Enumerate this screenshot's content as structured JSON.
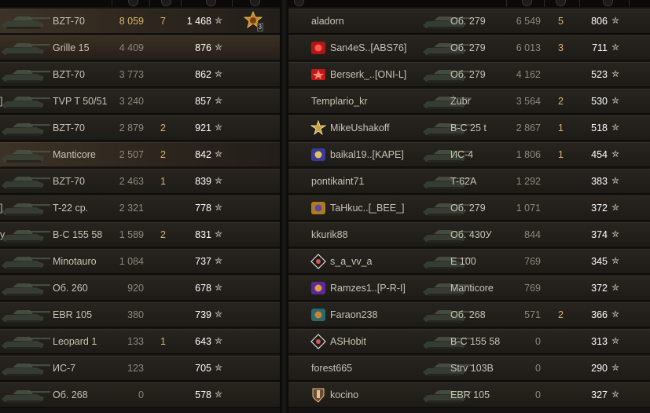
{
  "left_team": [
    {
      "player": "",
      "vehicle": "BZT-70",
      "damage": "8 059",
      "frags": "7",
      "score": "1 468",
      "medal_count": "3",
      "highlight": true
    },
    {
      "player": "",
      "vehicle": "Grille 15",
      "damage": "4 409",
      "frags": "",
      "score": "876",
      "is_player": true
    },
    {
      "player": "",
      "vehicle": "BZT-70",
      "damage": "3 773",
      "frags": "",
      "score": "862"
    },
    {
      "player": "]",
      "vehicle": "TVP T 50/51",
      "damage": "3 240",
      "frags": "",
      "score": "857"
    },
    {
      "player": "",
      "vehicle": "BZT-70",
      "damage": "2 879",
      "frags": "2",
      "score": "921"
    },
    {
      "player": "",
      "vehicle": "Manticore",
      "damage": "2 507",
      "frags": "2",
      "score": "842",
      "highlight": true
    },
    {
      "player": "",
      "vehicle": "BZT-70",
      "damage": "2 463",
      "frags": "1",
      "score": "839"
    },
    {
      "player": "]",
      "vehicle": "T-22 ср.",
      "damage": "2 321",
      "frags": "",
      "score": "778"
    },
    {
      "player": "y",
      "vehicle": "B-C 155 58",
      "damage": "1 589",
      "frags": "2",
      "score": "831"
    },
    {
      "player": "",
      "vehicle": "Minotauro",
      "damage": "1 084",
      "frags": "",
      "score": "737"
    },
    {
      "player": "",
      "vehicle": "Об. 260",
      "damage": "920",
      "frags": "",
      "score": "678"
    },
    {
      "player": "",
      "vehicle": "EBR 105",
      "damage": "380",
      "frags": "",
      "score": "739"
    },
    {
      "player": "",
      "vehicle": "Leopard 1",
      "damage": "133",
      "frags": "1",
      "score": "643"
    },
    {
      "player": "",
      "vehicle": "ИС-7",
      "damage": "123",
      "frags": "",
      "score": "705"
    },
    {
      "player": "",
      "vehicle": "Об. 268",
      "damage": "0",
      "frags": "",
      "score": "578"
    }
  ],
  "right_team": [
    {
      "player": "aladorn",
      "vehicle": "Об. 279",
      "damage": "6 549",
      "frags": "5",
      "score": "806",
      "clan_icon": "none"
    },
    {
      "player": "San4eS..[ABS76]",
      "vehicle": "Об. 279",
      "damage": "6 013",
      "frags": "3",
      "score": "711",
      "clan_icon": "clan-badge-red-icon"
    },
    {
      "player": "Berserk_..[ONI-L]",
      "vehicle": "Об. 279",
      "damage": "4 162",
      "frags": "",
      "score": "523",
      "clan_icon": "clan-badge-star-icon"
    },
    {
      "player": "Templario_kr",
      "vehicle": "Żubr",
      "damage": "3 564",
      "frags": "2",
      "score": "530",
      "clan_icon": "none"
    },
    {
      "player": "MikeUshakoff",
      "vehicle": "B-C 25 t",
      "damage": "2 867",
      "frags": "1",
      "score": "518",
      "clan_icon": "clan-badge-sun-icon"
    },
    {
      "player": "baikal19..[KAPE]",
      "vehicle": "ИС-4",
      "damage": "1 806",
      "frags": "1",
      "score": "454",
      "clan_icon": "clan-badge-emblem-icon"
    },
    {
      "player": "pontikaint71",
      "vehicle": "T-62A",
      "damage": "1 292",
      "frags": "",
      "score": "383",
      "clan_icon": "none"
    },
    {
      "player": "TaHkuc..[_BEE_]",
      "vehicle": "Об. 279",
      "damage": "1 071",
      "frags": "",
      "score": "372",
      "clan_icon": "clan-badge-bee-icon"
    },
    {
      "player": "kkurik88",
      "vehicle": "Об. 430У",
      "damage": "844",
      "frags": "",
      "score": "374",
      "clan_icon": "none"
    },
    {
      "player": "s_a_vv_a",
      "vehicle": "E 100",
      "damage": "769",
      "frags": "",
      "score": "345",
      "clan_icon": "clan-badge-diamond-icon"
    },
    {
      "player": "Ramzes1..[P-R-I]",
      "vehicle": "Manticore",
      "damage": "769",
      "frags": "",
      "score": "372",
      "clan_icon": "clan-badge-purple-icon"
    },
    {
      "player": "Faraon238",
      "vehicle": "Об. 268",
      "damage": "571",
      "frags": "2",
      "score": "366",
      "clan_icon": "clan-badge-teal-icon"
    },
    {
      "player": "ASHobit",
      "vehicle": "B-C 155 58",
      "damage": "0",
      "frags": "",
      "score": "313",
      "clan_icon": "clan-badge-diamond-icon"
    },
    {
      "player": "forest665",
      "vehicle": "Strv 103B",
      "damage": "0",
      "frags": "",
      "score": "290",
      "clan_icon": "none"
    },
    {
      "player": "kocino",
      "vehicle": "EBR 105",
      "damage": "0",
      "frags": "",
      "score": "327",
      "clan_icon": "clan-badge-shield-icon"
    }
  ],
  "star_glyph": "✮",
  "colors": {
    "frags": "#d9b56b",
    "score": "#ffffff",
    "damage": "#8c887d",
    "text": "#c9c3b4"
  }
}
